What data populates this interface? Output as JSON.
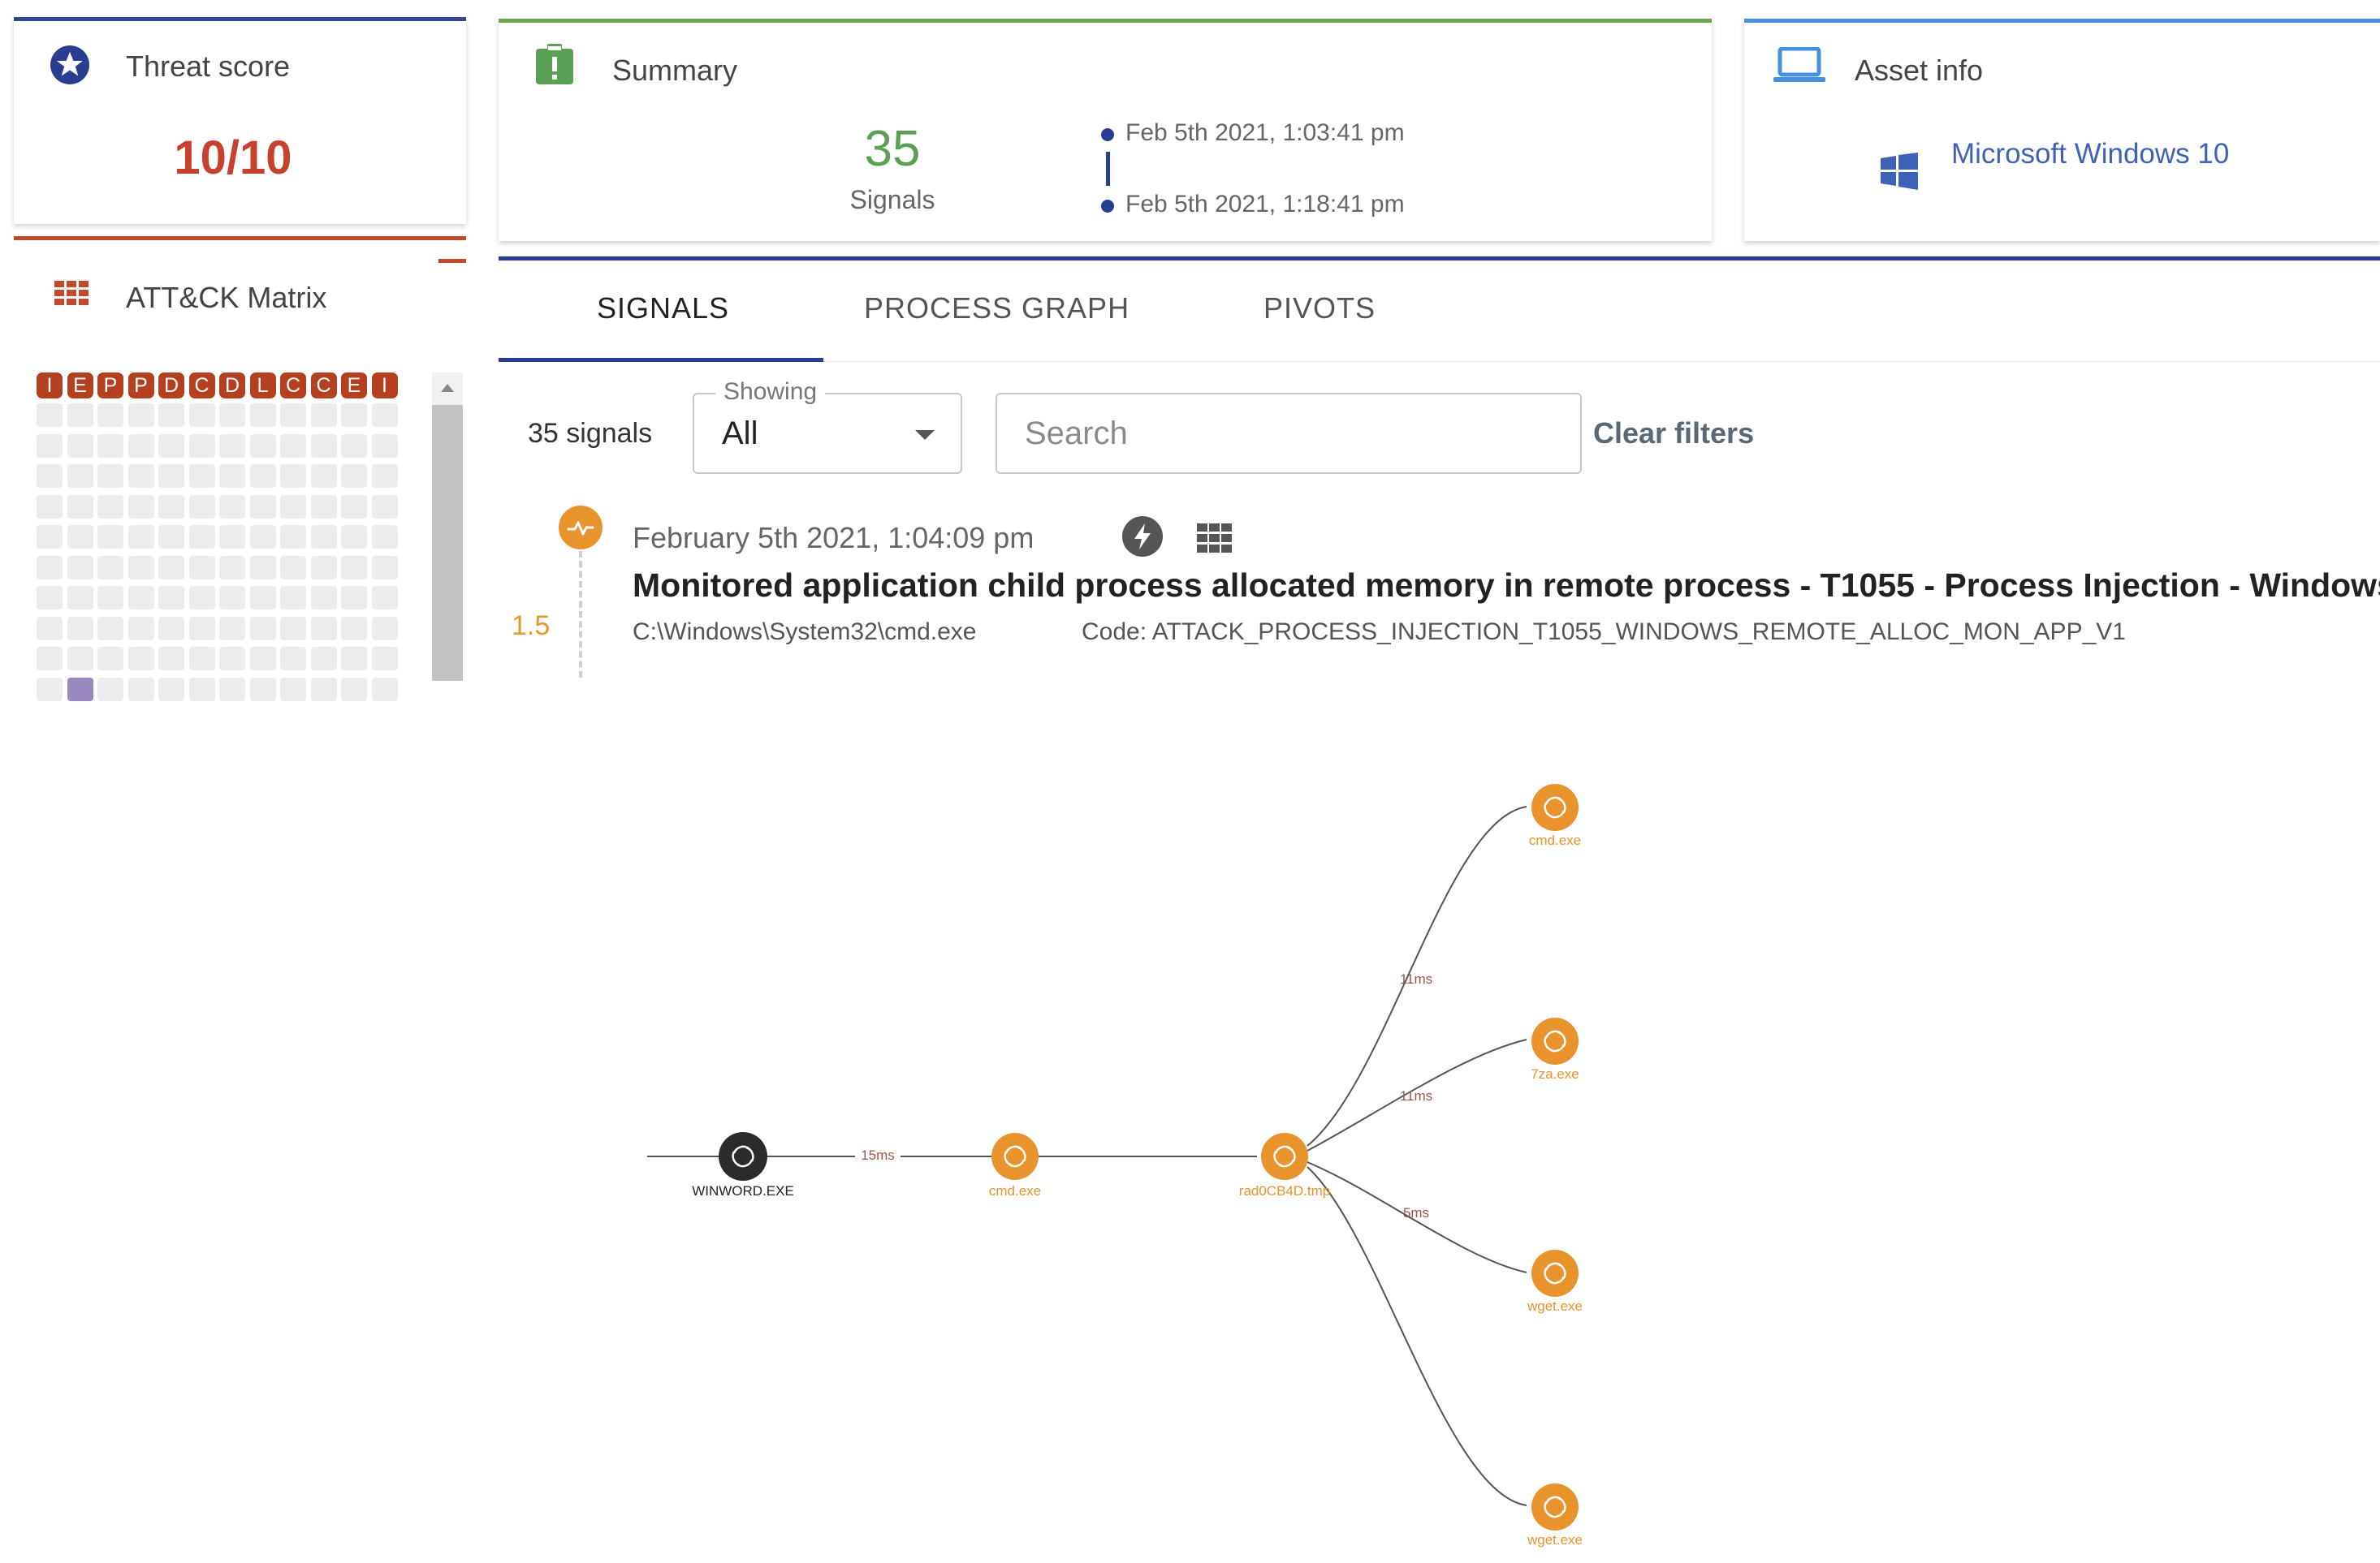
{
  "threat_card": {
    "title": "Threat score",
    "score": "10/10"
  },
  "attack_card": {
    "title": "ATT&CK Matrix"
  },
  "matrix": {
    "tactics": [
      "I",
      "E",
      "P",
      "P",
      "D",
      "C",
      "D",
      "L",
      "C",
      "C",
      "E",
      "I"
    ]
  },
  "summary_card": {
    "title": "Summary",
    "signal_count": "35",
    "signal_label": "Signals",
    "start_time": "Feb 5th 2021, 1:03:41 pm",
    "end_time": "Feb 5th 2021, 1:18:41 pm"
  },
  "asset_card": {
    "title": "Asset info",
    "os": "Microsoft Windows 10"
  },
  "tabs": [
    {
      "label": "SIGNALS",
      "active": true
    },
    {
      "label": "PROCESS GRAPH",
      "active": false
    },
    {
      "label": "PIVOTS",
      "active": false
    }
  ],
  "filters": {
    "count_label": "35 signals",
    "showing_label": "Showing",
    "showing_value": "All",
    "search_placeholder": "Search",
    "clear_label": "Clear filters"
  },
  "signal": {
    "score": "1.5",
    "date": "February 5th 2021, 1:04:09 pm",
    "title": "Monitored application child process allocated memory in remote process - T1055 - Process Injection - Windows",
    "path": "C:\\Windows\\System32\\cmd.exe",
    "code": "Code: ATTACK_PROCESS_INJECTION_T1055_WINDOWS_REMOTE_ALLOC_MON_APP_V1"
  },
  "process_graph": {
    "nodes": [
      "WINWORD.EXE",
      "cmd.exe",
      "rad0CB4D.tmp",
      "cmd.exe",
      "7za.exe",
      "wget.exe",
      "wget.exe"
    ],
    "edge_labels": [
      "15ms",
      "11ms",
      "11ms",
      "5ms"
    ]
  },
  "colors": {
    "navy": "#2a3e91",
    "green": "#6aa84f",
    "blue": "#4a90e2",
    "red": "#c14a2c",
    "orange": "#e9932c",
    "root_node": "#2b2b2b",
    "edge_label": "#a0524c"
  },
  "icons": [
    "star-icon",
    "clipboard-alert-icon",
    "laptop-icon",
    "windows-logo-icon",
    "grid-icon",
    "scroll-up-icon",
    "caret-down-icon",
    "activity-icon",
    "bolt-icon",
    "process-icon"
  ]
}
